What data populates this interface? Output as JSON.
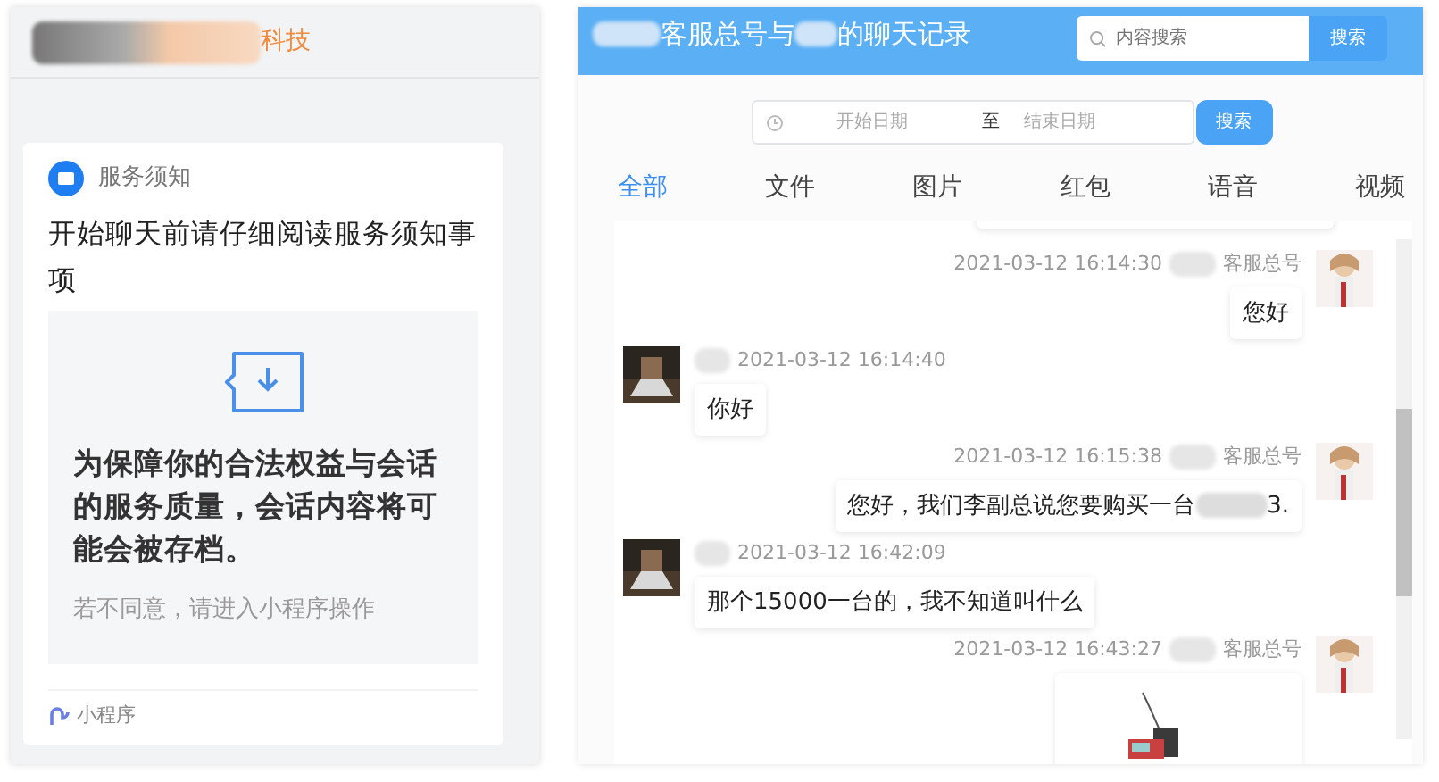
{
  "left_header": {
    "title": "科技"
  },
  "notice_card": {
    "label": "服务须知",
    "title": "开始聊天前请仔细阅读服务须知事项",
    "body": "为保障你的合法权益与会话的服务质量，会话内容将可能会被存档。",
    "hint": "若不同意，请进入小程序操作",
    "footer": "小程序"
  },
  "chat_header": {
    "title_parts": [
      "客服总号与",
      "的聊天记录"
    ],
    "search": {
      "placeholder": "内容搜索"
    },
    "search_button": "搜索"
  },
  "date_filter": {
    "start_placeholder": "开始日期",
    "separator": "至",
    "end_placeholder": "结束日期",
    "button": "搜索"
  },
  "tabs": [
    {
      "label": "全部",
      "selected": true
    },
    {
      "label": "文件",
      "selected": false
    },
    {
      "label": "图片",
      "selected": false
    },
    {
      "label": "红包",
      "selected": false
    },
    {
      "label": "语音",
      "selected": false
    },
    {
      "label": "视频",
      "selected": false
    }
  ],
  "messages": [
    {
      "outgoing": true,
      "time": "2021-03-12 16:14:30",
      "sender": "客服总号",
      "kind": "text",
      "parts": [
        "您好"
      ]
    },
    {
      "outgoing": false,
      "time": "2021-03-12 16:14:40",
      "kind": "text",
      "parts": [
        "你好"
      ]
    },
    {
      "outgoing": true,
      "time": "2021-03-12 16:15:38",
      "sender": "客服总号",
      "kind": "text",
      "parts": [
        "您好，我们李副总说您要购买一台",
        "3."
      ]
    },
    {
      "outgoing": false,
      "time": "2021-03-12 16:42:09",
      "kind": "text",
      "parts": [
        "那个15000一台的，我不知道叫什么"
      ]
    },
    {
      "outgoing": true,
      "time": "2021-03-12 16:43:27",
      "sender": "客服总号"
    }
  ]
}
